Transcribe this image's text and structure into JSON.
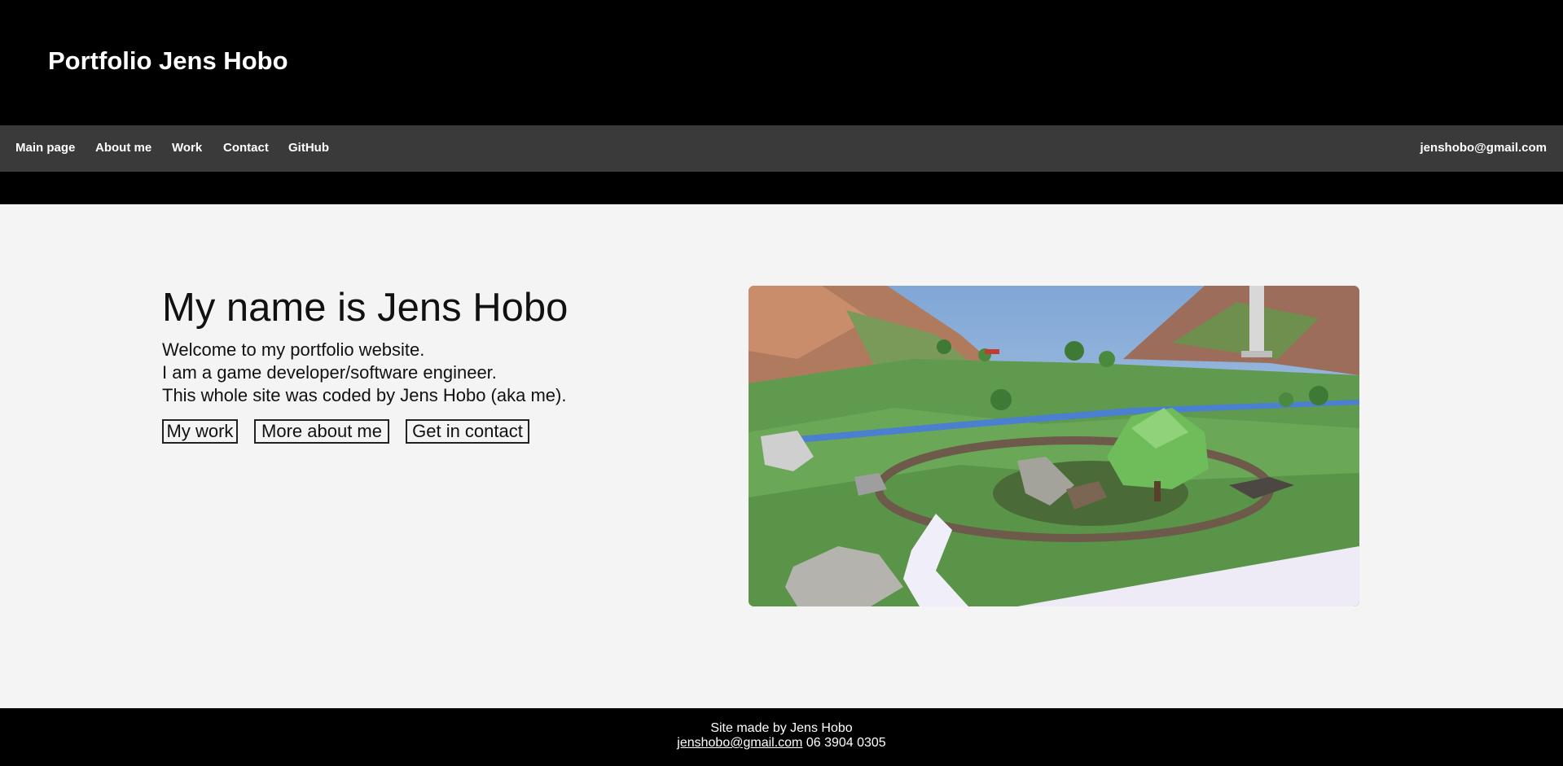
{
  "header": {
    "title": "Portfolio Jens Hobo"
  },
  "nav": {
    "items": [
      {
        "label": "Main page"
      },
      {
        "label": "About me"
      },
      {
        "label": "Work"
      },
      {
        "label": "Contact"
      },
      {
        "label": "GitHub"
      }
    ],
    "email": "jenshobo@gmail.com"
  },
  "hero": {
    "heading": "My name is Jens Hobo",
    "lines": [
      "Welcome to my portfolio website.",
      "I am a game developer/software engineer.",
      "This whole site was coded by Jens Hobo (aka me)."
    ],
    "buttons": [
      {
        "label": "My work"
      },
      {
        "label": "More about me"
      },
      {
        "label": "Get in contact"
      }
    ]
  },
  "footer": {
    "made_by": "Site made by Jens Hobo",
    "email": "jenshobo@gmail.com",
    "phone": " 06 3904 0305"
  }
}
